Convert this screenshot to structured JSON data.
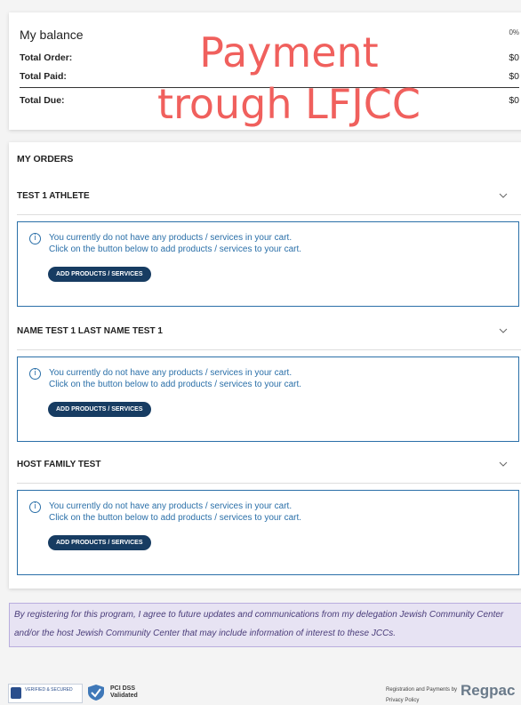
{
  "balance": {
    "title": "My balance",
    "percent": "0%",
    "rows": [
      {
        "label": "Total Order:",
        "value": "$0"
      },
      {
        "label": "Total Paid:",
        "value": "$0"
      },
      {
        "label": "Total Due:",
        "value": "$0"
      }
    ]
  },
  "overlay": {
    "line1": "Payment",
    "line2": "trough LFJCC",
    "color": "#f0605d"
  },
  "orders": {
    "heading": "MY ORDERS",
    "sections": [
      {
        "title": "TEST 1 ATHLETE",
        "message_line1": "You currently do not have any products / services in your cart.",
        "message_line2": "Click on the button below to add products / services to your cart.",
        "button": "ADD PRODUCTS / SERVICES"
      },
      {
        "title": "NAME TEST 1 LAST NAME TEST 1",
        "message_line1": "You currently do not have any products / services in your cart.",
        "message_line2": "Click on the button below to add products / services to your cart.",
        "button": "ADD PRODUCTS / SERVICES"
      },
      {
        "title": "HOST FAMILY TEST",
        "message_line1": "You currently do not have any products / services in your cart.",
        "message_line2": "Click on the button below to add products / services to your cart.",
        "button": "ADD PRODUCTS / SERVICES"
      }
    ],
    "icons": {
      "expand": "chevron-down-icon",
      "info": "info-icon"
    }
  },
  "consent": {
    "line1": "By registering for this program, I agree to future updates and communications from my delegation Jewish Community Center",
    "line2": "and/or the host Jewish Community Center that may include information of interest to these JCCs."
  },
  "footer": {
    "badge_security": "VERIFIED & SECURED",
    "badge_pci_line1": "PCI DSS",
    "badge_pci_line2": "Validated",
    "registration_text": "Registration and Payments by",
    "privacy_link": "Privacy Policy",
    "logo_text": "Regpac"
  }
}
